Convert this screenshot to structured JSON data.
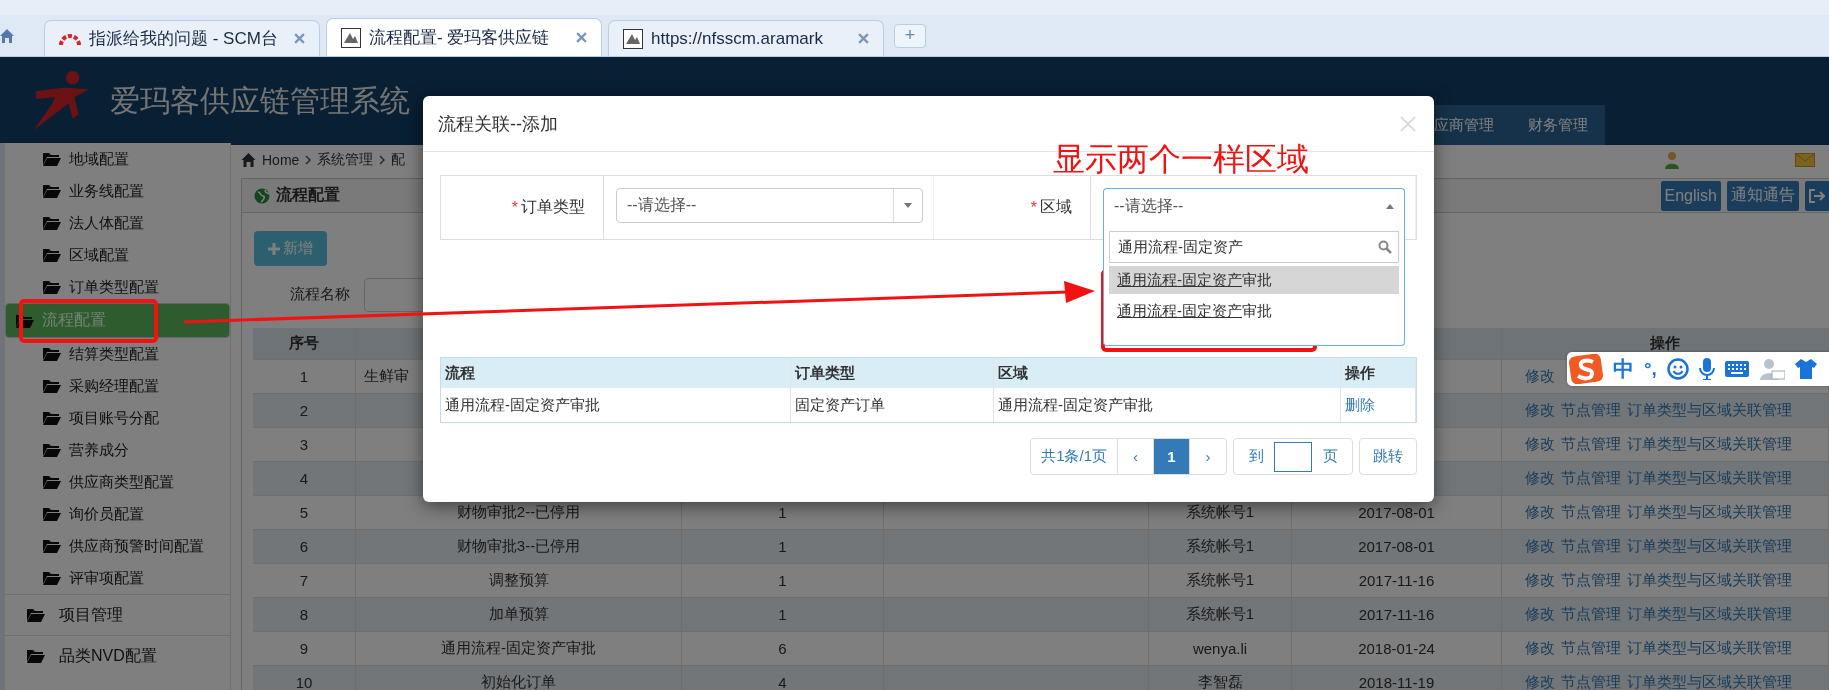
{
  "browser": {
    "tabs": [
      {
        "title": "指派给我的问题 - SCM台",
        "kind": "tracker",
        "selected": false
      },
      {
        "title": "流程配置- 爱玛客供应链",
        "kind": "site",
        "selected": true
      },
      {
        "title": "https://nfsscm.aramark",
        "kind": "site",
        "selected": false
      }
    ],
    "new_tab": "+"
  },
  "header": {
    "title": "爱玛客供应链管理系统",
    "nav": [
      {
        "label": "应商管理"
      },
      {
        "label": "财务管理"
      }
    ]
  },
  "sidebar": {
    "items": [
      {
        "label": "地域配置",
        "selected": false
      },
      {
        "label": "业务线配置",
        "selected": false
      },
      {
        "label": "法人体配置",
        "selected": false
      },
      {
        "label": "区域配置",
        "selected": false
      },
      {
        "label": "订单类型配置",
        "selected": false
      },
      {
        "label": "流程配置",
        "selected": true
      },
      {
        "label": "结算类型配置",
        "selected": false
      },
      {
        "label": "采购经理配置",
        "selected": false
      },
      {
        "label": "项目账号分配",
        "selected": false
      },
      {
        "label": "营养成分",
        "selected": false
      },
      {
        "label": "供应商类型配置",
        "selected": false
      },
      {
        "label": "询价员配置",
        "selected": false
      },
      {
        "label": "供应商预警时间配置",
        "selected": false
      },
      {
        "label": "评审项配置",
        "selected": false
      }
    ],
    "sections": [
      {
        "label": "项目管理"
      },
      {
        "label": "品类NVD配置"
      }
    ]
  },
  "breadcrumb": [
    "Home",
    "系统管理",
    "配"
  ],
  "panel": {
    "title": "流程配置",
    "buttons": [
      "English",
      "通知通告"
    ],
    "add_button": "新增",
    "search_label": "流程名称"
  },
  "table": {
    "columns": {
      "first": "序号",
      "last": "操作"
    },
    "rows": [
      {
        "index": "1",
        "name": "生鲜审",
        "clipped": true,
        "actions": [
          "修改"
        ]
      },
      {
        "index": "2",
        "actions": [
          "修改",
          "节点管理",
          "订单类型与区域关联管理"
        ]
      },
      {
        "index": "3",
        "actions": [
          "修改",
          "节点管理",
          "订单类型与区域关联管理"
        ]
      },
      {
        "index": "4",
        "actions": [
          "修改",
          "节点管理",
          "订单类型与区域关联管理"
        ]
      },
      {
        "index": "5",
        "name": "财物审批2--已停用",
        "clipped": false,
        "version": "1",
        "creator": "系统帐号1",
        "date": "2017-08-01",
        "actions": [
          "修改",
          "节点管理",
          "订单类型与区域关联管理"
        ]
      },
      {
        "index": "6",
        "name": "财物审批3--已停用",
        "clipped": false,
        "version": "1",
        "creator": "系统帐号1",
        "date": "2017-08-01",
        "actions": [
          "修改",
          "节点管理",
          "订单类型与区域关联管理"
        ]
      },
      {
        "index": "7",
        "name": "调整预算",
        "clipped": false,
        "version": "1",
        "creator": "系统帐号1",
        "date": "2017-11-16",
        "actions": [
          "修改",
          "节点管理",
          "订单类型与区域关联管理"
        ]
      },
      {
        "index": "8",
        "name": "加单预算",
        "clipped": false,
        "version": "1",
        "creator": "系统帐号1",
        "date": "2017-11-16",
        "actions": [
          "修改",
          "节点管理",
          "订单类型与区域关联管理"
        ]
      },
      {
        "index": "9",
        "name": "通用流程-固定资产审批",
        "clipped": false,
        "version": "6",
        "creator": "wenya.li",
        "date": "2018-01-24",
        "actions": [
          "修改",
          "节点管理",
          "订单类型与区域关联管理"
        ]
      },
      {
        "index": "10",
        "name": "初始化订单",
        "clipped": false,
        "version": "4",
        "creator": "李智磊",
        "date": "2018-11-19",
        "actions": [
          "修改",
          "节点管理",
          "订单类型与区域关联管理"
        ]
      }
    ]
  },
  "dialog": {
    "title": "流程关联--添加",
    "fields": [
      {
        "mark": "*",
        "label": "订单类型",
        "placeholder": "--请选择--",
        "expanded": false
      },
      {
        "mark": "*",
        "label": "区域",
        "placeholder": "--请选择--",
        "expanded": true
      }
    ],
    "dropdown": {
      "search": "通用流程-固定资产",
      "options": [
        {
          "text": "通用流程-固定资产审批",
          "selected": true
        },
        {
          "text": "通用流程-固定资产审批",
          "selected": false
        }
      ]
    },
    "table": {
      "columns": [
        "流程",
        "订单类型",
        "区域",
        "操作"
      ],
      "rows": [
        {
          "cells": [
            "通用流程-固定资产审批",
            "固定资产订单",
            "通用流程-固定资产审批"
          ],
          "action": "删除"
        }
      ]
    },
    "pager": {
      "summary": "共1条/1页",
      "prev": "‹",
      "pages": [
        {
          "label": "1",
          "selected": true
        }
      ],
      "next": "›",
      "goto_prefix": "到",
      "goto_suffix": "页",
      "go": "跳转"
    }
  },
  "annotation": {
    "text": "显示两个一样区域"
  },
  "ime_bar": {
    "mode": "中",
    "punctuation": "°,"
  }
}
